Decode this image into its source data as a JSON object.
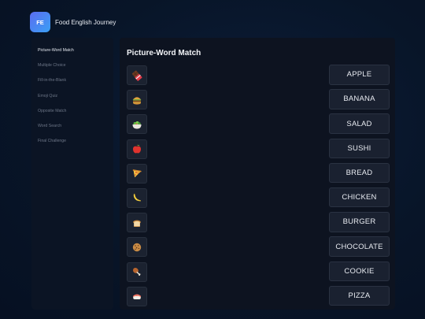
{
  "header": {
    "logo_text": "FE",
    "title": "Food English Journey"
  },
  "sidebar": {
    "items": [
      {
        "label": "Picture-Word Match",
        "active": true
      },
      {
        "label": "Multiple Choice",
        "active": false
      },
      {
        "label": "Fill-in-the-Blank",
        "active": false
      },
      {
        "label": "Emoji Quiz",
        "active": false
      },
      {
        "label": "Opposite Match",
        "active": false
      },
      {
        "label": "Word Search",
        "active": false
      },
      {
        "label": "Final Challenge",
        "active": false
      }
    ]
  },
  "main": {
    "title": "Picture-Word Match",
    "emojis": [
      {
        "icon": "chocolate-bar-icon"
      },
      {
        "icon": "burger-icon"
      },
      {
        "icon": "salad-bowl-icon"
      },
      {
        "icon": "apple-icon"
      },
      {
        "icon": "pizza-slice-icon"
      },
      {
        "icon": "banana-icon"
      },
      {
        "icon": "bread-icon"
      },
      {
        "icon": "cookie-icon"
      },
      {
        "icon": "chicken-leg-icon"
      },
      {
        "icon": "sushi-icon"
      }
    ],
    "words": [
      "APPLE",
      "BANANA",
      "SALAD",
      "SUSHI",
      "BREAD",
      "CHICKEN",
      "BURGER",
      "CHOCOLATE",
      "COOKIE",
      "PIZZA"
    ]
  },
  "colors": {
    "accent_start": "#5b6cf0",
    "accent_end": "#3aa0f5",
    "panel": "#0d1320",
    "tile": "#1b2230"
  }
}
